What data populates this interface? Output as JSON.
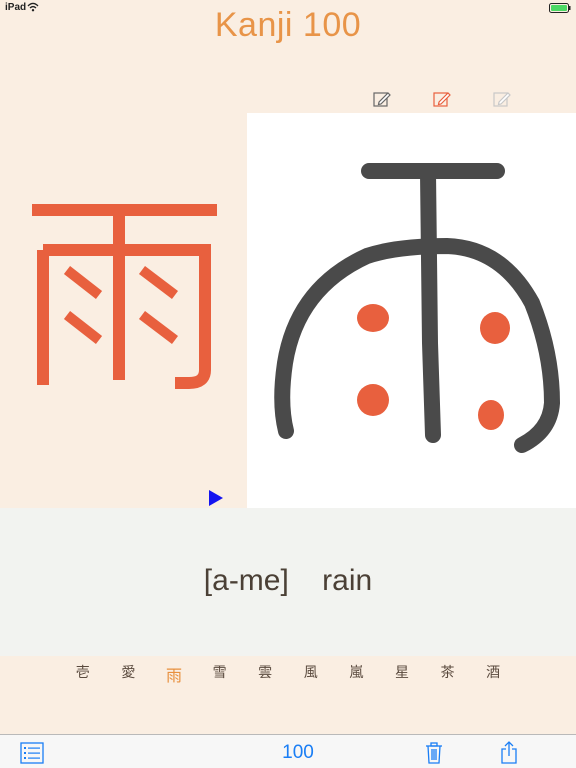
{
  "status_bar": {
    "device": "iPad"
  },
  "app": {
    "title": "Kanji 100"
  },
  "card": {
    "kanji": "雨",
    "reading": "[a-me]    rain"
  },
  "kanji_list": [
    {
      "char": "壱",
      "active": false
    },
    {
      "char": "愛",
      "active": false
    },
    {
      "char": "雨",
      "active": true
    },
    {
      "char": "雪",
      "active": false
    },
    {
      "char": "雲",
      "active": false
    },
    {
      "char": "風",
      "active": false
    },
    {
      "char": "嵐",
      "active": false
    },
    {
      "char": "星",
      "active": false
    },
    {
      "char": "茶",
      "active": false
    },
    {
      "char": "酒",
      "active": false
    }
  ],
  "toolbar": {
    "count": "100"
  },
  "colors": {
    "accent_orange": "#e8603e",
    "title_orange": "#e89448",
    "ink": "#4a4a4a",
    "link_blue": "#1a7ef5",
    "play_blue": "#1414f0"
  },
  "icons": {
    "edit_pens": [
      "edit-pen-dark",
      "edit-pen-orange",
      "edit-pen-light"
    ],
    "toolbar": [
      "list-icon",
      "trash-icon",
      "share-icon"
    ],
    "play": "play-icon"
  }
}
